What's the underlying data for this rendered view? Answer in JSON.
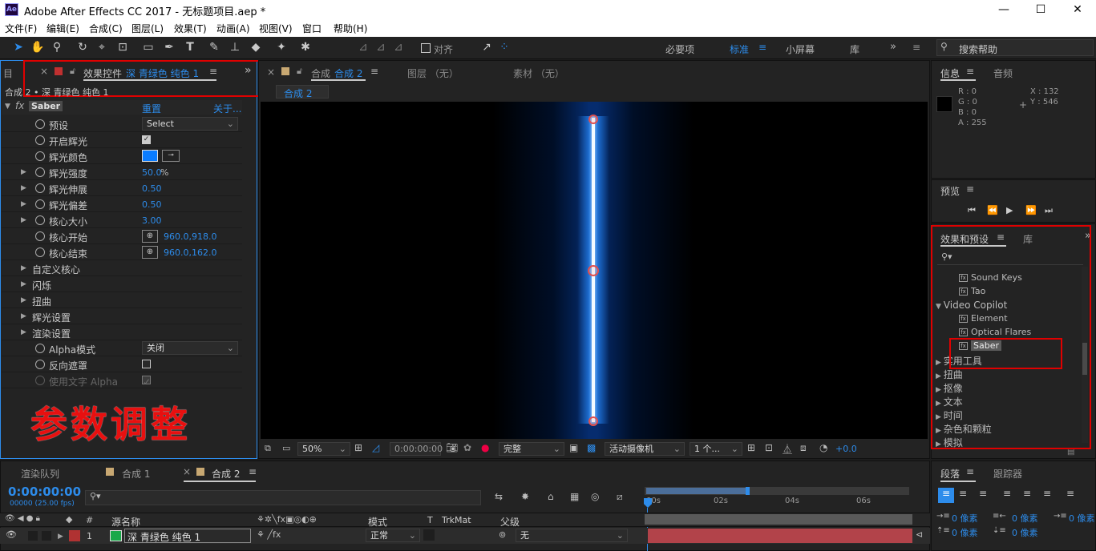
{
  "window": {
    "title": "Adobe After Effects CC 2017 - 无标题项目.aep *",
    "logo": "Ae",
    "minimize": "—",
    "maximize": "☐",
    "close": "✕"
  },
  "menu": [
    "文件(F)",
    "编辑(E)",
    "合成(C)",
    "图层(L)",
    "效果(T)",
    "动画(A)",
    "视图(V)",
    "窗口",
    "帮助(H)"
  ],
  "toolbar": {
    "align_label": "对齐",
    "workspaces": [
      "必要项",
      "标准",
      "小屏幕",
      "库"
    ],
    "search_help": "搜索帮助"
  },
  "effect_controls": {
    "tab_label": "效果控件",
    "tab_layer": "深 青绿色 纯色 1",
    "left_stub": "目",
    "breadcrumb": "合成 2 • 深 青绿色 纯色 1",
    "effect_name": "Saber",
    "reset": "重置",
    "about": "关于...",
    "rows": [
      {
        "label": "预设",
        "value": "Select",
        "kind": "dropdown"
      },
      {
        "label": "开启辉光",
        "value": "",
        "kind": "checkbox-on"
      },
      {
        "label": "辉光颜色",
        "value": "",
        "kind": "color",
        "color": "#0a7cff"
      },
      {
        "label": "辉光强度",
        "value": "50.0",
        "suffix": "%",
        "kind": "number",
        "expand": true
      },
      {
        "label": "辉光伸展",
        "value": "0.50",
        "kind": "number",
        "expand": true
      },
      {
        "label": "辉光偏差",
        "value": "0.50",
        "kind": "number",
        "expand": true
      },
      {
        "label": "核心大小",
        "value": "3.00",
        "kind": "number",
        "expand": true
      },
      {
        "label": "核心开始",
        "value": "960.0,918.0",
        "kind": "point"
      },
      {
        "label": "核心结束",
        "value": "960.0,162.0",
        "kind": "point"
      },
      {
        "label": "自定义核心",
        "kind": "group"
      },
      {
        "label": "闪烁",
        "kind": "group"
      },
      {
        "label": "扭曲",
        "kind": "group"
      },
      {
        "label": "辉光设置",
        "kind": "group"
      },
      {
        "label": "渲染设置",
        "kind": "group"
      },
      {
        "label": "Alpha模式",
        "value": "关闭",
        "kind": "dropdown"
      },
      {
        "label": "反向遮罩",
        "value": "",
        "kind": "checkbox-off"
      },
      {
        "label": "使用文字 Alpha",
        "value": "",
        "kind": "checkbox-dim"
      }
    ],
    "overlay_text": "参数调整"
  },
  "viewer": {
    "tab_label": "合成",
    "tab_name": "合成 2",
    "layer_tab": "图层 （无）",
    "footage_tab": "素材 （无）",
    "subtab": "合成 2",
    "zoom": "50%",
    "timecode": "0:00:00:00",
    "quality": "完整",
    "camera": "活动摄像机",
    "views": "1 个...",
    "exposure": "+0.0"
  },
  "info": {
    "tab": "信息",
    "audio_tab": "音频",
    "r": "R : 0",
    "g": "G : 0",
    "b": "B : 0",
    "a": "A : 255",
    "x": "X : 132",
    "y": "Y : 546"
  },
  "preview": {
    "tab": "预览"
  },
  "effects_presets": {
    "tab": "效果和预设",
    "lib_tab": "库",
    "items": [
      {
        "label": "Sound Keys",
        "kind": "fx"
      },
      {
        "label": "Tao",
        "kind": "fx"
      },
      {
        "label": "Video Copilot",
        "kind": "open-folder"
      },
      {
        "label": "Element",
        "kind": "fx"
      },
      {
        "label": "Optical Flares",
        "kind": "fx"
      },
      {
        "label": "Saber",
        "kind": "fx-selected"
      },
      {
        "label": "实用工具",
        "kind": "folder"
      },
      {
        "label": "扭曲",
        "kind": "folder"
      },
      {
        "label": "抠像",
        "kind": "folder"
      },
      {
        "label": "文本",
        "kind": "folder"
      },
      {
        "label": "时间",
        "kind": "folder"
      },
      {
        "label": "杂色和颗粒",
        "kind": "folder"
      },
      {
        "label": "模拟",
        "kind": "folder"
      }
    ]
  },
  "paragraph": {
    "tab": "段落",
    "tracker_tab": "跟踪器",
    "indents": [
      "0 像素",
      "0 像素",
      "0 像素",
      "0 像素",
      "0 像素"
    ]
  },
  "timeline": {
    "tabs": [
      "渲染队列",
      "合成 1",
      "合成 2"
    ],
    "timecode": "0:00:00:00",
    "fps": "00000 (25.00 fps)",
    "columns": {
      "num": "#",
      "source": "源名称",
      "mode": "模式",
      "t": "T",
      "trkmat": "TrkMat",
      "parent": "父级"
    },
    "ruler": [
      "00s",
      "02s",
      "04s",
      "06s"
    ],
    "layer": {
      "num": "1",
      "name": "深 青绿色 纯色 1",
      "mode": "正常",
      "parent": "无",
      "color": "#1aa84a",
      "label_color": "#b03232"
    }
  }
}
